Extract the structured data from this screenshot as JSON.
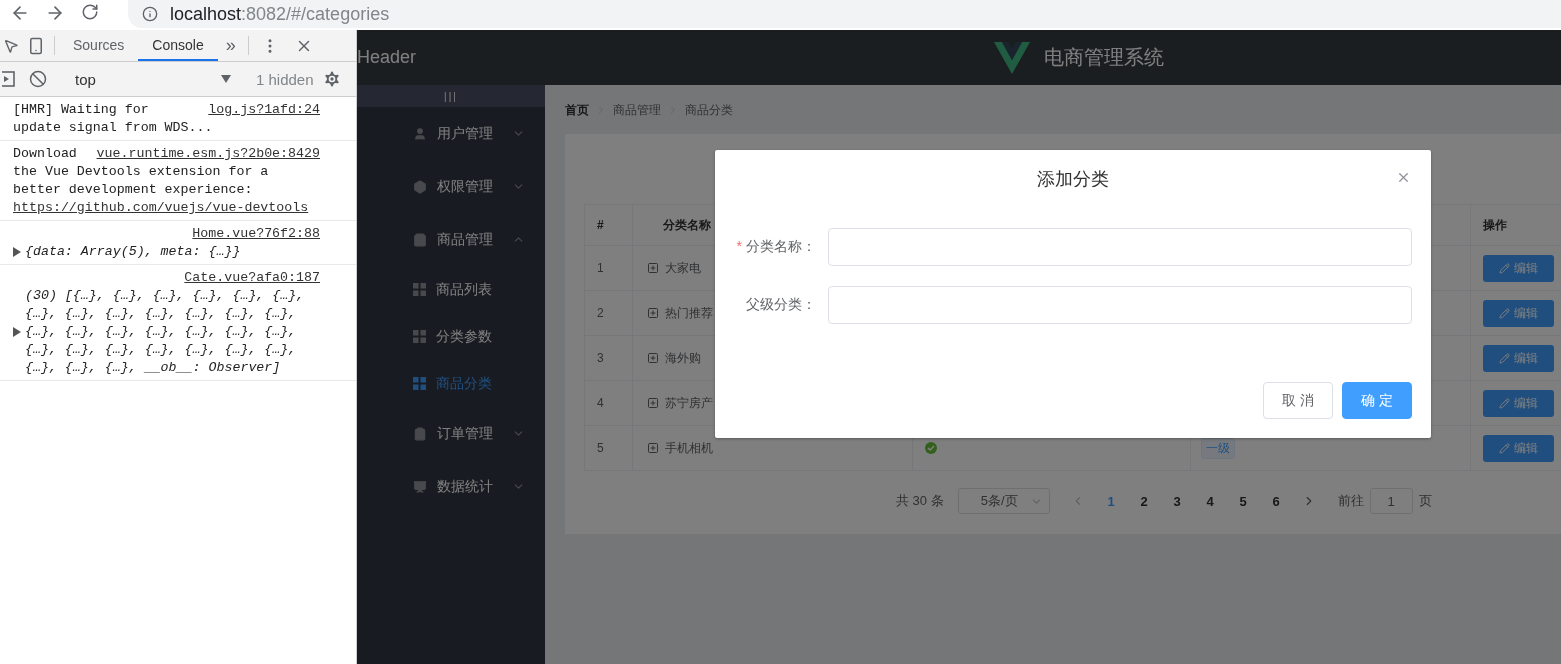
{
  "browser": {
    "url_host": "localhost",
    "url_path": ":8082/#/categories"
  },
  "devtools": {
    "tabs": [
      {
        "label": "Sources",
        "selected": false
      },
      {
        "label": "Console",
        "selected": true
      }
    ],
    "more": "»",
    "context": "top",
    "hidden": "1 hidden",
    "messages": [
      {
        "kind": "log",
        "lead": "[HMR] Waiting for",
        "text": "update signal from WDS...",
        "source": "log.js?1afd:24"
      },
      {
        "kind": "log",
        "lead": "Download",
        "text": "the Vue Devtools extension for a better development experience:",
        "link": "https://github.com/vuejs/vue-devtools",
        "source": "vue.runtime.esm.js?2b0e:8429"
      },
      {
        "kind": "object",
        "text": "{data: Array(5), meta: {…}}",
        "source": "Home.vue?76f2:88"
      },
      {
        "kind": "object",
        "text": "(30) [{…}, {…}, {…}, {…}, {…}, {…}, {…}, {…}, {…}, {…}, {…}, {…}, {…}, {…}, {…}, {…}, {…}, {…}, {…}, {…}, {…}, {…}, {…}, {…}, {…}, {…}, {…}, {…}, {…}, {…}, __ob__: Observer]",
        "source": "Cate.vue?afa0:187"
      }
    ]
  },
  "app": {
    "header_text": "Header",
    "brand": "电商管理系统",
    "toggle": "|||",
    "menu": [
      {
        "label": "用户管理",
        "expanded": false
      },
      {
        "label": "权限管理",
        "expanded": false
      },
      {
        "label": "商品管理",
        "expanded": true,
        "children": [
          {
            "label": "商品列表",
            "selected": false
          },
          {
            "label": "分类参数",
            "selected": false
          },
          {
            "label": "商品分类",
            "selected": true
          }
        ]
      },
      {
        "label": "订单管理",
        "expanded": false
      },
      {
        "label": "数据统计",
        "expanded": false
      }
    ],
    "breadcrumb": [
      "首页",
      "商品管理",
      "商品分类"
    ],
    "table": {
      "columns": [
        {
          "kind": "text",
          "label": "#"
        },
        {
          "kind": "text",
          "label": "分类名称"
        },
        {
          "kind": "blank"
        },
        {
          "kind": "blank"
        },
        {
          "kind": "text",
          "label": "操作"
        }
      ],
      "rows": [
        {
          "index": "1",
          "name": "大家电",
          "action": "编辑"
        },
        {
          "index": "2",
          "name": "热门推荐",
          "action": "编辑"
        },
        {
          "index": "3",
          "name": "海外购",
          "action": "编辑"
        },
        {
          "index": "4",
          "name": "苏宁房产",
          "action": "编辑"
        },
        {
          "index": "5",
          "name": "手机相机",
          "valid": true,
          "level_tag": "一级",
          "action": "编辑"
        }
      ]
    },
    "pagination": {
      "total": "共 30 条",
      "page_size": "5条/页",
      "pages": [
        {
          "label": "1",
          "selected": true
        },
        {
          "label": "2",
          "selected": false
        },
        {
          "label": "3",
          "selected": false
        },
        {
          "label": "4",
          "selected": false
        },
        {
          "label": "5",
          "selected": false
        },
        {
          "label": "6",
          "selected": false
        }
      ],
      "goto_label": "前往",
      "goto_value": "1",
      "goto_suffix": "页"
    },
    "dialog": {
      "title": "添加分类",
      "required_mark": "*",
      "fields": [
        {
          "label": "分类名称：",
          "required": true
        },
        {
          "label": "父级分类：",
          "required": false
        }
      ],
      "buttons": [
        {
          "label": "取 消",
          "kind": "default"
        },
        {
          "label": "确 定",
          "kind": "primary"
        }
      ]
    }
  }
}
